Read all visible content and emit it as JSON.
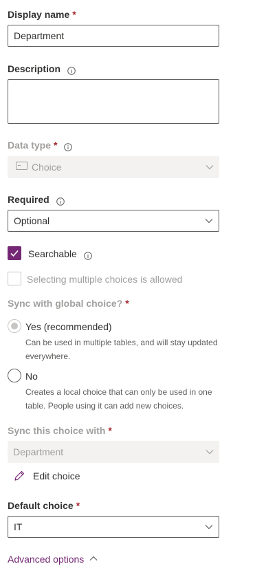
{
  "display_name": {
    "label": "Display name",
    "required_mark": "*",
    "value": "Department"
  },
  "description": {
    "label": "Description",
    "value": ""
  },
  "data_type": {
    "label": "Data type",
    "required_mark": "*",
    "value": "Choice",
    "icon": "choice-type-icon"
  },
  "required": {
    "label": "Required",
    "value": "Optional"
  },
  "searchable": {
    "label": "Searchable",
    "checked": true
  },
  "multiple_choices": {
    "label": "Selecting multiple choices is allowed",
    "checked": false
  },
  "sync_global": {
    "label": "Sync with global choice?",
    "required_mark": "*",
    "options": [
      {
        "label": "Yes (recommended)",
        "description": "Can be used in multiple tables, and will stay updated everywhere.",
        "selected": true
      },
      {
        "label": "No",
        "description": "Creates a local choice that can only be used in one table. People using it can add new choices.",
        "selected": false
      }
    ]
  },
  "sync_choice": {
    "label": "Sync this choice with",
    "required_mark": "*",
    "value": "Department"
  },
  "edit_choice": {
    "label": "Edit choice"
  },
  "default_choice": {
    "label": "Default choice",
    "required_mark": "*",
    "value": "IT"
  },
  "advanced_options": {
    "label": "Advanced options"
  },
  "colors": {
    "accent": "#742774",
    "required": "#a4262c",
    "disabled_text": "#a19f9d",
    "disabled_bg": "#f3f2f1"
  }
}
